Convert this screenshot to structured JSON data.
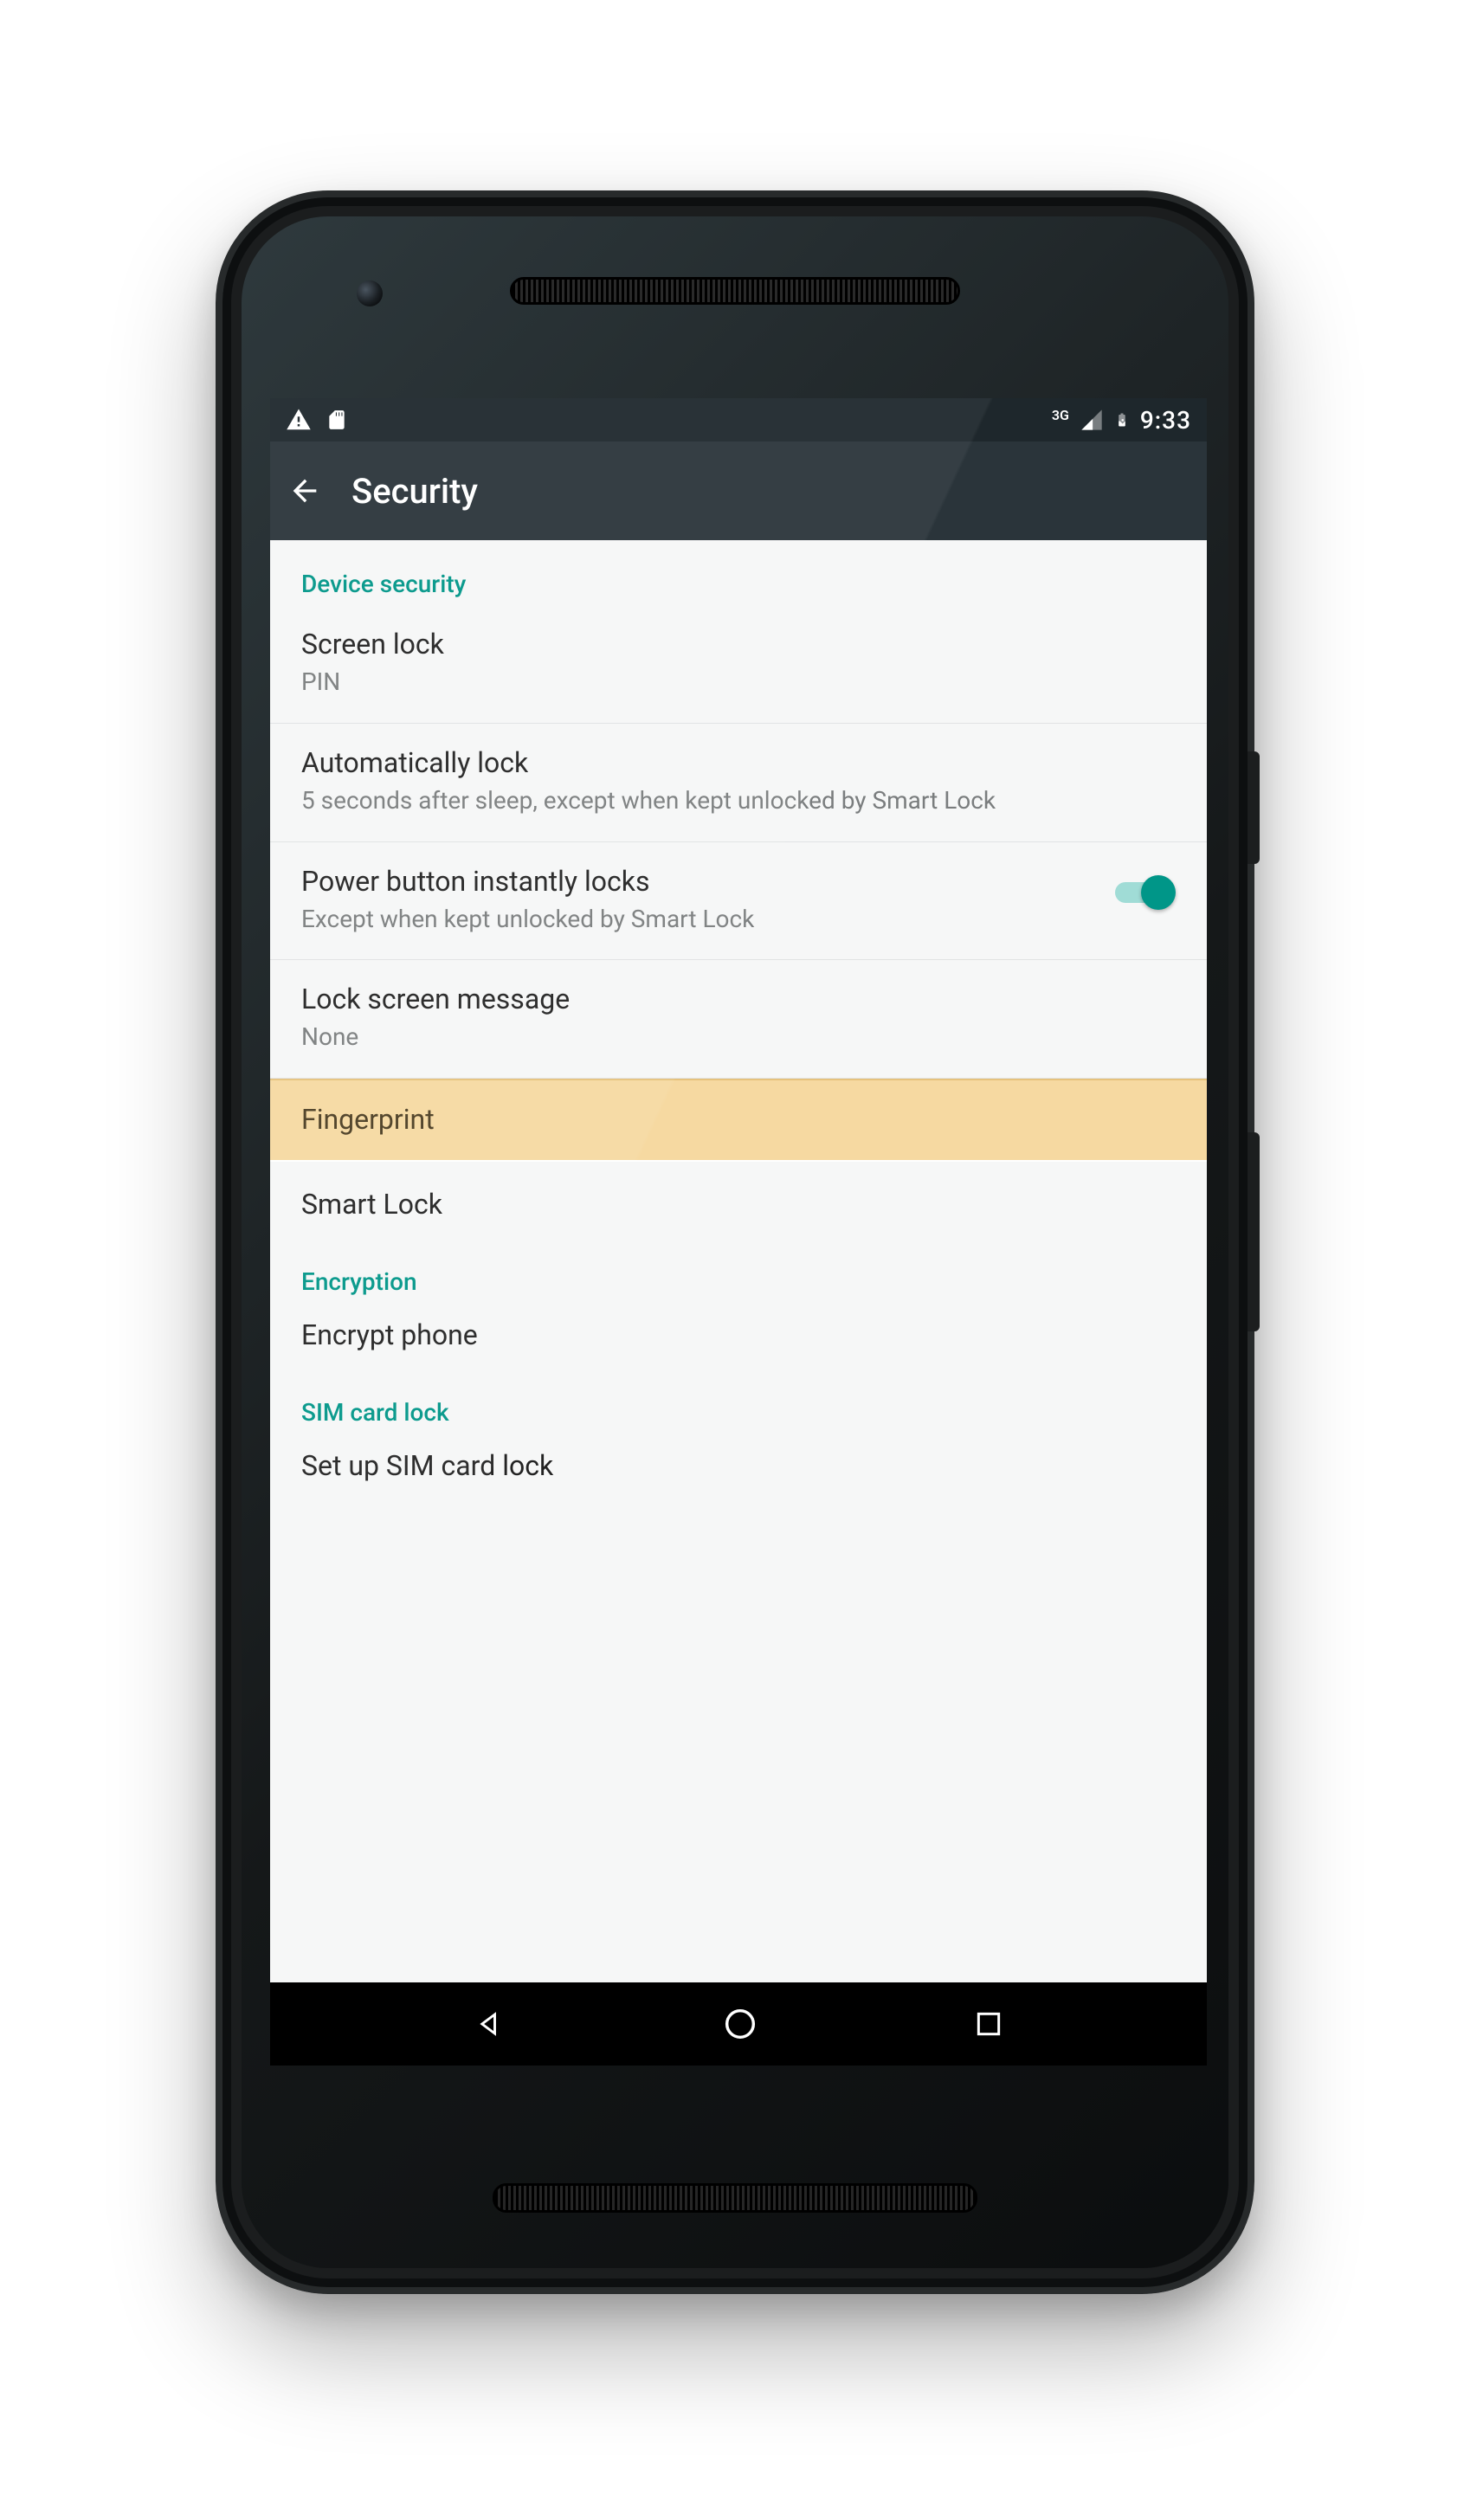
{
  "status": {
    "network_label": "3G",
    "time": "9:33"
  },
  "appbar": {
    "title": "Security"
  },
  "sections": {
    "device_security": "Device security",
    "encryption": "Encryption",
    "sim": "SIM card lock"
  },
  "rows": {
    "screen_lock": {
      "title": "Screen lock",
      "subtitle": "PIN"
    },
    "auto_lock": {
      "title": "Automatically lock",
      "subtitle": "5 seconds after sleep, except when kept unlocked by Smart Lock"
    },
    "power_lock": {
      "title": "Power button instantly locks",
      "subtitle": "Except when kept unlocked by Smart Lock",
      "toggle_on": true
    },
    "lock_msg": {
      "title": "Lock screen message",
      "subtitle": "None"
    },
    "fingerprint": {
      "title": "Fingerprint"
    },
    "smart_lock": {
      "title": "Smart Lock"
    },
    "encrypt": {
      "title": "Encrypt phone"
    },
    "sim_setup": {
      "title": "Set up SIM card lock"
    }
  },
  "colors": {
    "accent": "#009688",
    "highlight": "#f6d9a1",
    "appbar": "#2a343a"
  }
}
